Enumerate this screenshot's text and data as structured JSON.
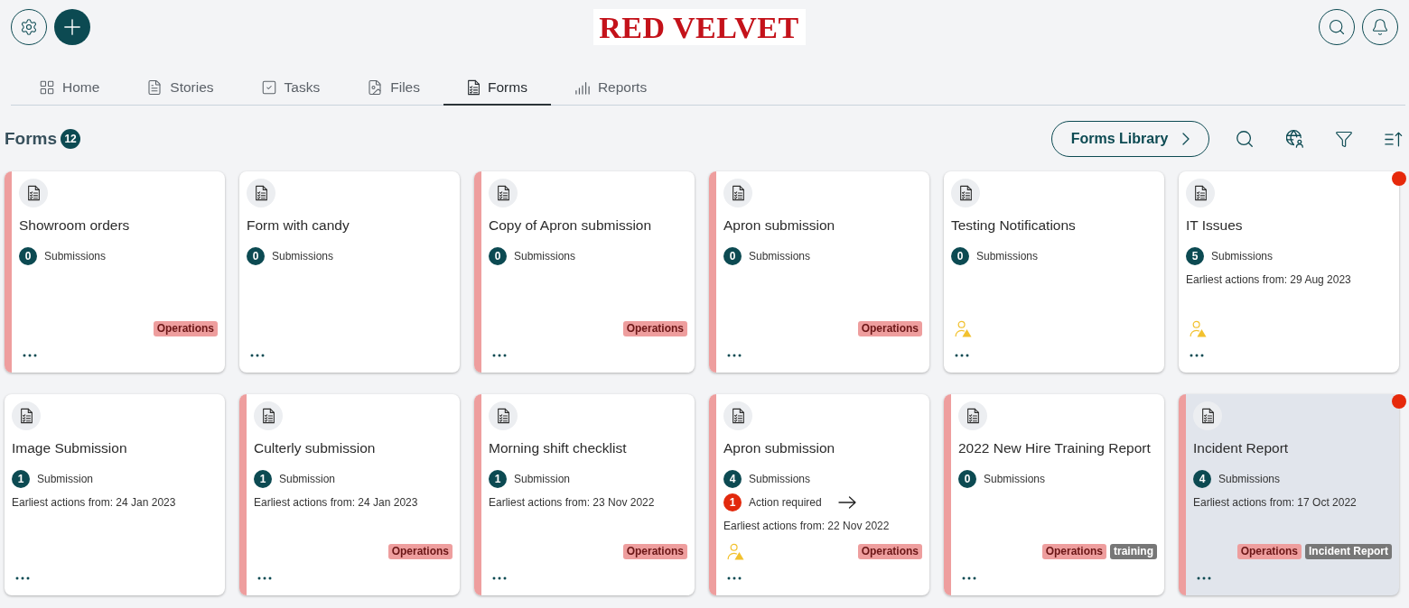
{
  "header": {
    "logo": "RED VELVET"
  },
  "tabs": [
    {
      "label": "Home",
      "selected": false
    },
    {
      "label": "Stories",
      "selected": false
    },
    {
      "label": "Tasks",
      "selected": false
    },
    {
      "label": "Files",
      "selected": false
    },
    {
      "label": "Forms",
      "selected": true
    },
    {
      "label": "Reports",
      "selected": false
    }
  ],
  "toolbar": {
    "title": "Forms",
    "count": "12",
    "library_button": "Forms Library"
  },
  "cards": [
    {
      "title": "Showroom orders",
      "accent_stripe": true,
      "selected": false,
      "notification": false,
      "user_alert": false,
      "stats": [
        {
          "kind": "submissions",
          "count": "0",
          "label": "Submissions"
        }
      ],
      "tags": [
        {
          "label": "Operations",
          "color": "#ee9e9e"
        }
      ]
    },
    {
      "title": "Form with candy",
      "accent_stripe": false,
      "selected": false,
      "notification": false,
      "user_alert": false,
      "stats": [
        {
          "kind": "submissions",
          "count": "0",
          "label": "Submissions"
        }
      ]
    },
    {
      "title": "Copy of Apron submission",
      "accent_stripe": true,
      "selected": false,
      "notification": false,
      "user_alert": false,
      "stats": [
        {
          "kind": "submissions",
          "count": "0",
          "label": "Submissions"
        }
      ],
      "tags": [
        {
          "label": "Operations",
          "color": "#ee9e9e"
        }
      ]
    },
    {
      "title": "Apron submission",
      "accent_stripe": true,
      "selected": false,
      "notification": false,
      "user_alert": false,
      "stats": [
        {
          "kind": "submissions",
          "count": "0",
          "label": "Submissions"
        }
      ],
      "tags": [
        {
          "label": "Operations",
          "color": "#ee9e9e"
        }
      ]
    },
    {
      "title": "Testing Notifications",
      "accent_stripe": false,
      "selected": false,
      "notification": false,
      "user_alert": true,
      "stats": [
        {
          "kind": "submissions",
          "count": "0",
          "label": "Submissions"
        }
      ]
    },
    {
      "title": "IT Issues",
      "accent_stripe": false,
      "selected": false,
      "notification": true,
      "user_alert": true,
      "stats": [
        {
          "kind": "submissions",
          "count": "5",
          "label": "Submissions"
        }
      ],
      "earliest": "Earliest actions from: 29 Aug 2023"
    },
    {
      "title": "Image Submission",
      "accent_stripe": false,
      "selected": false,
      "notification": false,
      "user_alert": false,
      "stats": [
        {
          "kind": "submissions",
          "count": "1",
          "label": "Submission"
        }
      ],
      "earliest": "Earliest actions from: 24 Jan 2023"
    },
    {
      "title": "Culterly submission",
      "accent_stripe": true,
      "selected": false,
      "notification": false,
      "user_alert": false,
      "stats": [
        {
          "kind": "submissions",
          "count": "1",
          "label": "Submission"
        }
      ],
      "earliest": "Earliest actions from: 24 Jan 2023",
      "tags": [
        {
          "label": "Operations",
          "color": "#ee9e9e"
        }
      ]
    },
    {
      "title": "Morning shift checklist",
      "accent_stripe": true,
      "selected": false,
      "notification": false,
      "user_alert": false,
      "stats": [
        {
          "kind": "submissions",
          "count": "1",
          "label": "Submission"
        }
      ],
      "earliest": "Earliest actions from: 23 Nov 2022",
      "tags": [
        {
          "label": "Operations",
          "color": "#ee9e9e"
        }
      ]
    },
    {
      "title": "Apron submission",
      "accent_stripe": true,
      "selected": false,
      "notification": false,
      "user_alert": true,
      "stats": [
        {
          "kind": "submissions",
          "count": "4",
          "label": "Submissions"
        },
        {
          "kind": "action",
          "count": "1",
          "label": "Action required"
        }
      ],
      "earliest": "Earliest actions from: 22 Nov 2022",
      "tags": [
        {
          "label": "Operations",
          "color": "#ee9e9e"
        }
      ]
    },
    {
      "title": "2022 New Hire Training Report",
      "accent_stripe": true,
      "selected": false,
      "notification": false,
      "user_alert": false,
      "stats": [
        {
          "kind": "submissions",
          "count": "0",
          "label": "Submissions"
        }
      ],
      "tags": [
        {
          "label": "Operations",
          "color": "#ee9e9e"
        },
        {
          "label": "training",
          "color": "#777777"
        }
      ]
    },
    {
      "title": "Incident Report",
      "accent_stripe": true,
      "selected": true,
      "notification": true,
      "user_alert": false,
      "stats": [
        {
          "kind": "submissions",
          "count": "4",
          "label": "Submissions"
        }
      ],
      "earliest": "Earliest actions from: 17 Oct 2022",
      "tags": [
        {
          "label": "Operations",
          "color": "#ee9e9e"
        },
        {
          "label": "Incident Report",
          "color": "#777777"
        }
      ]
    }
  ]
}
